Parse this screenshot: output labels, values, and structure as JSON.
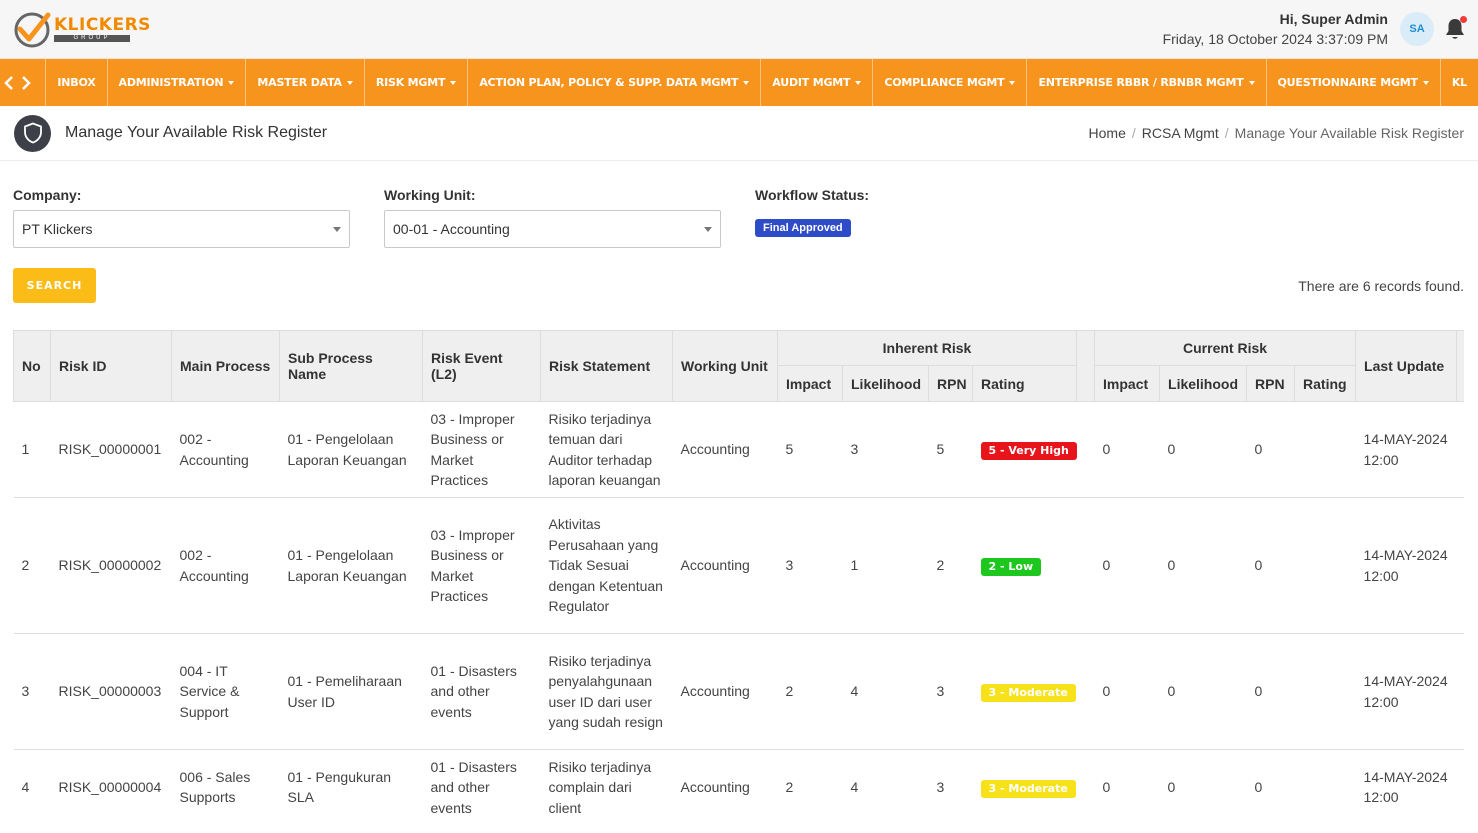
{
  "header": {
    "logo_text": "KLICKERS",
    "logo_sub": "GROUP",
    "greeting": "Hi, Super Admin",
    "datetime": "Friday, 18 October 2024 3:37:09 PM",
    "avatar_initials": "SA"
  },
  "nav": {
    "prev_icon": "chevron-left-icon",
    "next_icon": "chevron-right-icon",
    "items": [
      {
        "label": "INBOX",
        "dropdown": false
      },
      {
        "label": "ADMINISTRATION",
        "dropdown": true
      },
      {
        "label": "MASTER DATA",
        "dropdown": true
      },
      {
        "label": "RISK MGMT",
        "dropdown": true
      },
      {
        "label": "ACTION PLAN, POLICY & SUPP. DATA MGMT",
        "dropdown": true
      },
      {
        "label": "AUDIT MGMT",
        "dropdown": true
      },
      {
        "label": "COMPLIANCE MGMT",
        "dropdown": true
      },
      {
        "label": "ENTERPRISE RBBR / RBNBR MGMT",
        "dropdown": true
      },
      {
        "label": "QUESTIONNAIRE MGMT",
        "dropdown": true
      },
      {
        "label": "KL",
        "dropdown": false
      }
    ]
  },
  "page": {
    "title": "Manage Your Available Risk Register",
    "breadcrumb": [
      "Home",
      "RCSA Mgmt",
      "Manage Your Available Risk Register"
    ]
  },
  "filters": {
    "company_label": "Company:",
    "company_value": "PT Klickers",
    "unit_label": "Working Unit:",
    "unit_value": "00-01 - Accounting",
    "status_label": "Workflow Status:",
    "status_value": "Final Approved"
  },
  "search": {
    "button_label": "SEARCH",
    "records_text": "There are 6 records found."
  },
  "table": {
    "headers": {
      "no": "No",
      "risk_id": "Risk ID",
      "main_process": "Main Process",
      "sub_process": "Sub Process Name",
      "risk_event": "Risk Event (L2)",
      "risk_statement": "Risk Statement",
      "working_unit": "Working Unit",
      "inherent": "Inherent Risk",
      "current": "Current Risk",
      "last_update": "Last Update",
      "impact": "Impact",
      "likelihood": "Likelihood",
      "rpn": "RPN",
      "rating": "Rating"
    },
    "rows": [
      {
        "no": "1",
        "risk_id": "RISK_00000001",
        "main_process": "002 - Accounting",
        "sub_process": "01 - Pengelolaan Laporan Keuangan",
        "risk_event": "03 - Improper Business or Market Practices",
        "risk_statement": "Risiko terjadinya temuan dari Auditor terhadap laporan keuangan",
        "working_unit": "Accounting",
        "inh_impact": "5",
        "inh_likelihood": "3",
        "inh_rpn": "5",
        "inh_rating": "5 - Very High",
        "inh_rating_color": "#e8141c",
        "cur_impact": "0",
        "cur_likelihood": "0",
        "cur_rpn": "0",
        "cur_rating": "",
        "last_update": "14-MAY-2024 12:00"
      },
      {
        "no": "2",
        "risk_id": "RISK_00000002",
        "main_process": "002 - Accounting",
        "sub_process": "01 - Pengelolaan Laporan Keuangan",
        "risk_event": "03 - Improper Business or Market Practices",
        "risk_statement": "Aktivitas Perusahaan yang Tidak Sesuai dengan Ketentuan Regulator",
        "working_unit": "Accounting",
        "inh_impact": "3",
        "inh_likelihood": "1",
        "inh_rpn": "2",
        "inh_rating": "2 - Low",
        "inh_rating_color": "#1ec71e",
        "cur_impact": "0",
        "cur_likelihood": "0",
        "cur_rpn": "0",
        "cur_rating": "",
        "last_update": "14-MAY-2024 12:00"
      },
      {
        "no": "3",
        "risk_id": "RISK_00000003",
        "main_process": "004 - IT Service & Support",
        "sub_process": "01 - Pemeliharaan User ID",
        "risk_event": "01 - Disasters and other events",
        "risk_statement": "Risiko terjadinya penyalahgunaan user ID dari user yang sudah resign",
        "working_unit": "Accounting",
        "inh_impact": "2",
        "inh_likelihood": "4",
        "inh_rpn": "3",
        "inh_rating": "3 - Moderate",
        "inh_rating_color": "#f6e11a",
        "cur_impact": "0",
        "cur_likelihood": "0",
        "cur_rpn": "0",
        "cur_rating": "",
        "last_update": "14-MAY-2024 12:00"
      },
      {
        "no": "4",
        "risk_id": "RISK_00000004",
        "main_process": "006 - Sales Supports",
        "sub_process": "01 - Pengukuran SLA",
        "risk_event": "01 - Disasters and other events",
        "risk_statement": "Risiko terjadinya complain dari client",
        "working_unit": "Accounting",
        "inh_impact": "2",
        "inh_likelihood": "4",
        "inh_rpn": "3",
        "inh_rating": "3 - Moderate",
        "inh_rating_color": "#f6e11a",
        "cur_impact": "0",
        "cur_likelihood": "0",
        "cur_rpn": "0",
        "cur_rating": "",
        "last_update": "14-MAY-2024 12:00"
      }
    ]
  },
  "colors": {
    "nav_bg": "#f7941d",
    "search_button": "#fbbc17",
    "status_badge": "#2e4bc8"
  }
}
